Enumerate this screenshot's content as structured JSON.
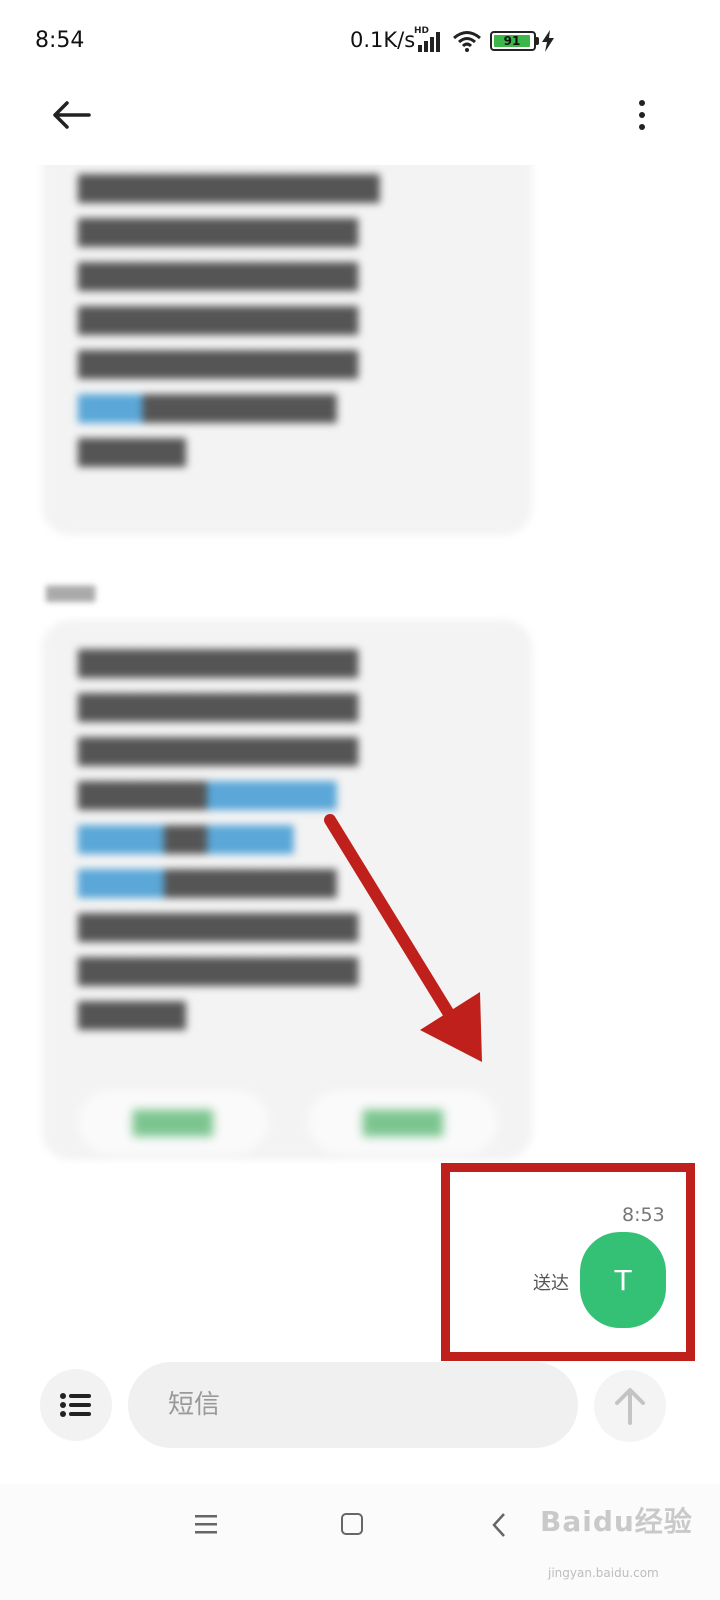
{
  "status_bar": {
    "time": "8:54",
    "net_speed": "0.1K/s",
    "hd_label": "HD",
    "battery_level": "91",
    "accent_battery": "#3cb549"
  },
  "conversation": {
    "sent_message": {
      "time": "8:53",
      "status": "送达",
      "text": "T",
      "bubble_color": "#34c176"
    }
  },
  "composer": {
    "placeholder": "短信"
  },
  "watermark": {
    "brand": "Baidu经验",
    "url": "jingyan.baidu.com"
  },
  "annotation_color": "#c0201b"
}
